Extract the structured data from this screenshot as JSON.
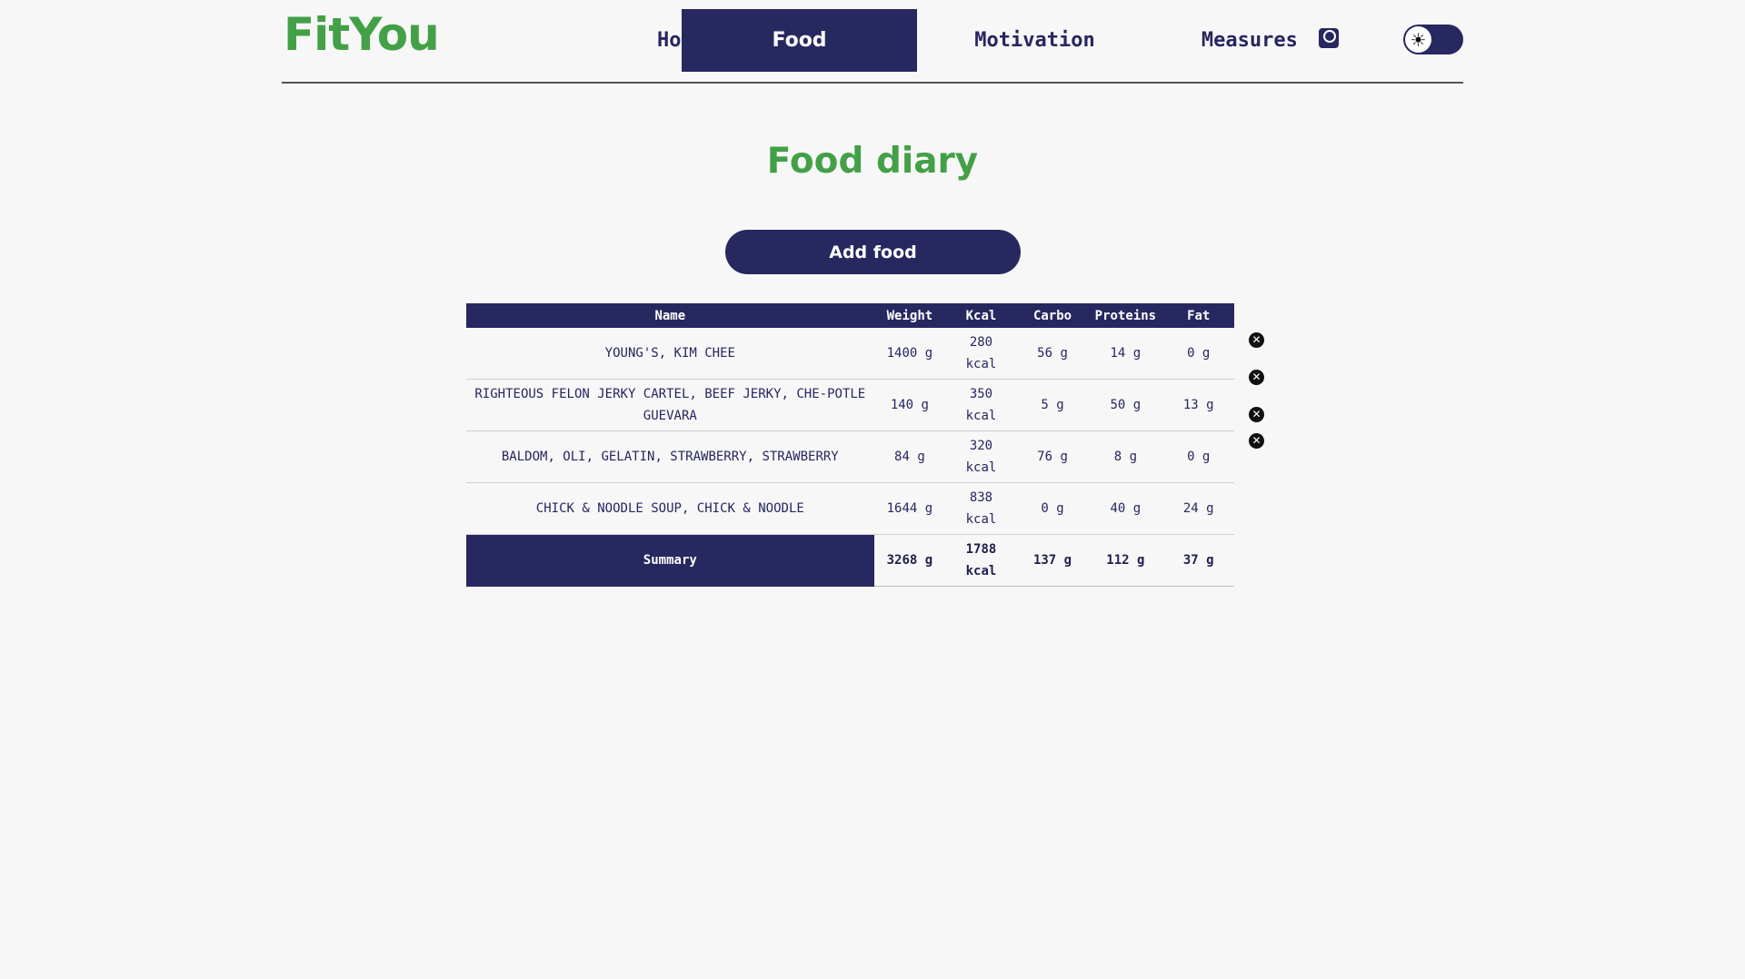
{
  "app": {
    "logo": "FitYou"
  },
  "nav": {
    "home": "Home",
    "food": "Food",
    "motivation": "Motivation",
    "measures": "Measures",
    "active": "Food"
  },
  "theme_toggle": {
    "icon": "sun-icon",
    "glyph": "☀"
  },
  "page": {
    "title": "Food diary",
    "add_food_label": "Add food"
  },
  "table": {
    "headers": {
      "name": "Name",
      "weight": "Weight",
      "kcal": "Kcal",
      "carbo": "Carbo",
      "proteins": "Proteins",
      "fat": "Fat"
    },
    "rows": [
      {
        "name": "YOUNG'S, KIM CHEE",
        "weight": "1400 g",
        "kcal": "280 kcal",
        "carbo": "56 g",
        "proteins": "14 g",
        "fat": "0 g"
      },
      {
        "name": "RIGHTEOUS FELON JERKY CARTEL, BEEF JERKY, CHE-POTLE GUEVARA",
        "weight": "140 g",
        "kcal": "350 kcal",
        "carbo": "5 g",
        "proteins": "50 g",
        "fat": "13 g"
      },
      {
        "name": "BALDOM, OLI, GELATIN, STRAWBERRY, STRAWBERRY",
        "weight": "84 g",
        "kcal": "320 kcal",
        "carbo": "76 g",
        "proteins": "8 g",
        "fat": "0 g"
      },
      {
        "name": "CHICK & NOODLE SOUP, CHICK & NOODLE",
        "weight": "1644 g",
        "kcal": "838 kcal",
        "carbo": "0 g",
        "proteins": "40 g",
        "fat": "24 g"
      }
    ],
    "summary": {
      "label": "Summary",
      "weight": "3268 g",
      "kcal": "1788 kcal",
      "carbo": "137 g",
      "proteins": "112 g",
      "fat": "37 g"
    },
    "delete_icon": "close-circle-icon",
    "delete_glyph": "✕"
  }
}
